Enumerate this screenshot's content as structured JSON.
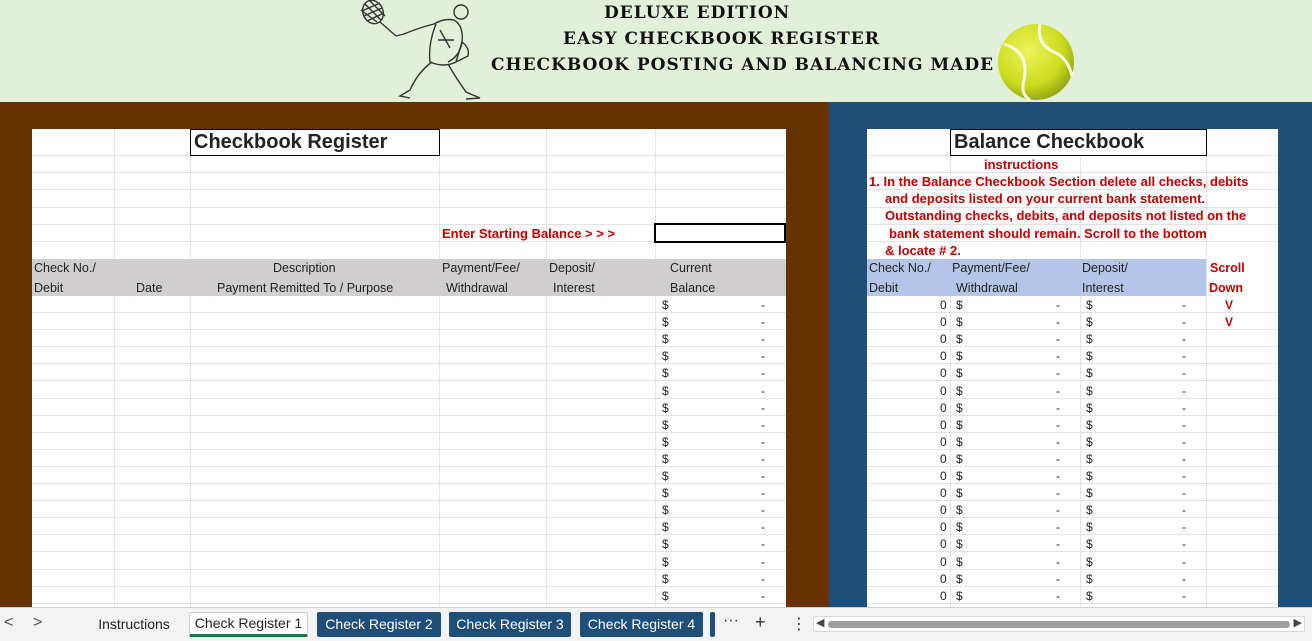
{
  "banner": {
    "line1": "DELUXE EDITION",
    "line2": "EASY CHECKBOOK REGISTER",
    "line3": "CHECKBOOK POSTING AND BALANCING MADE EASY"
  },
  "register": {
    "title": "Checkbook Register",
    "start_label": "Enter Starting Balance > > >",
    "start_value": "",
    "headers": {
      "check_no_1": "Check No./",
      "check_no_2": "Debit",
      "date": "Date",
      "description_1": "Description",
      "description_2": "Payment Remitted To / Purpose",
      "payment_1": "Payment/Fee/",
      "payment_2": "Withdrawal",
      "deposit_1": "Deposit/",
      "deposit_2": "Interest",
      "balance_1": "Current",
      "balance_2": "Balance"
    },
    "rows": [
      {
        "cur": "$",
        "bal": "-"
      },
      {
        "cur": "$",
        "bal": "-"
      },
      {
        "cur": "$",
        "bal": "-"
      },
      {
        "cur": "$",
        "bal": "-"
      },
      {
        "cur": "$",
        "bal": "-"
      },
      {
        "cur": "$",
        "bal": "-"
      },
      {
        "cur": "$",
        "bal": "-"
      },
      {
        "cur": "$",
        "bal": "-"
      },
      {
        "cur": "$",
        "bal": "-"
      },
      {
        "cur": "$",
        "bal": "-"
      },
      {
        "cur": "$",
        "bal": "-"
      },
      {
        "cur": "$",
        "bal": "-"
      },
      {
        "cur": "$",
        "bal": "-"
      },
      {
        "cur": "$",
        "bal": "-"
      },
      {
        "cur": "$",
        "bal": "-"
      },
      {
        "cur": "$",
        "bal": "-"
      },
      {
        "cur": "$",
        "bal": "-"
      },
      {
        "cur": "$",
        "bal": "-"
      }
    ]
  },
  "balance": {
    "title": "Balance Checkbook",
    "instructions_title": "instructions",
    "instructions": [
      "1. In the Balance Checkbook Section delete all checks, debits",
      "and deposits listed on your current bank statement.",
      "Outstanding checks, debits, and deposits not listed on the",
      "bank statement should remain.  Scroll to the bottom",
      "& locate # 2."
    ],
    "headers": {
      "check_no_1": "Check No./",
      "check_no_2": "Debit",
      "payment_1": "Payment/Fee/",
      "payment_2": "Withdrawal",
      "deposit_1": "Deposit/",
      "deposit_2": "Interest",
      "scroll_1": "Scroll",
      "scroll_2": "Down"
    },
    "rows": [
      {
        "num": "0",
        "c1": "$",
        "v1": "-",
        "c2": "$",
        "v2": "-",
        "mark": "V"
      },
      {
        "num": "0",
        "c1": "$",
        "v1": "-",
        "c2": "$",
        "v2": "-",
        "mark": "V"
      },
      {
        "num": "0",
        "c1": "$",
        "v1": "-",
        "c2": "$",
        "v2": "-",
        "mark": ""
      },
      {
        "num": "0",
        "c1": "$",
        "v1": "-",
        "c2": "$",
        "v2": "-",
        "mark": ""
      },
      {
        "num": "0",
        "c1": "$",
        "v1": "-",
        "c2": "$",
        "v2": "-",
        "mark": ""
      },
      {
        "num": "0",
        "c1": "$",
        "v1": "-",
        "c2": "$",
        "v2": "-",
        "mark": ""
      },
      {
        "num": "0",
        "c1": "$",
        "v1": "-",
        "c2": "$",
        "v2": "-",
        "mark": ""
      },
      {
        "num": "0",
        "c1": "$",
        "v1": "-",
        "c2": "$",
        "v2": "-",
        "mark": ""
      },
      {
        "num": "0",
        "c1": "$",
        "v1": "-",
        "c2": "$",
        "v2": "-",
        "mark": ""
      },
      {
        "num": "0",
        "c1": "$",
        "v1": "-",
        "c2": "$",
        "v2": "-",
        "mark": ""
      },
      {
        "num": "0",
        "c1": "$",
        "v1": "-",
        "c2": "$",
        "v2": "-",
        "mark": ""
      },
      {
        "num": "0",
        "c1": "$",
        "v1": "-",
        "c2": "$",
        "v2": "-",
        "mark": ""
      },
      {
        "num": "0",
        "c1": "$",
        "v1": "-",
        "c2": "$",
        "v2": "-",
        "mark": ""
      },
      {
        "num": "0",
        "c1": "$",
        "v1": "-",
        "c2": "$",
        "v2": "-",
        "mark": ""
      },
      {
        "num": "0",
        "c1": "$",
        "v1": "-",
        "c2": "$",
        "v2": "-",
        "mark": ""
      },
      {
        "num": "0",
        "c1": "$",
        "v1": "-",
        "c2": "$",
        "v2": "-",
        "mark": ""
      },
      {
        "num": "0",
        "c1": "$",
        "v1": "-",
        "c2": "$",
        "v2": "-",
        "mark": ""
      },
      {
        "num": "0",
        "c1": "$",
        "v1": "-",
        "c2": "$",
        "v2": "-",
        "mark": ""
      }
    ]
  },
  "tabs": {
    "prev": "<",
    "next": ">",
    "items": [
      "Instructions",
      "Check Register 1",
      "Check Register 2",
      "Check Register 3",
      "Check Register 4"
    ],
    "more": "···",
    "add": "+",
    "options": "⋮"
  },
  "colors": {
    "banner_bg": "#e2f0d9",
    "left_panel": "#663300",
    "right_panel": "#1f4e79",
    "register_header": "#d0cece",
    "balance_header": "#b4c6e7",
    "instruction_red": "#c00000",
    "ball": "#ccdd22"
  },
  "icons": [
    "tennis-player-illustration",
    "tennis-ball-icon",
    "scroll-left-icon",
    "scroll-right-icon"
  ]
}
